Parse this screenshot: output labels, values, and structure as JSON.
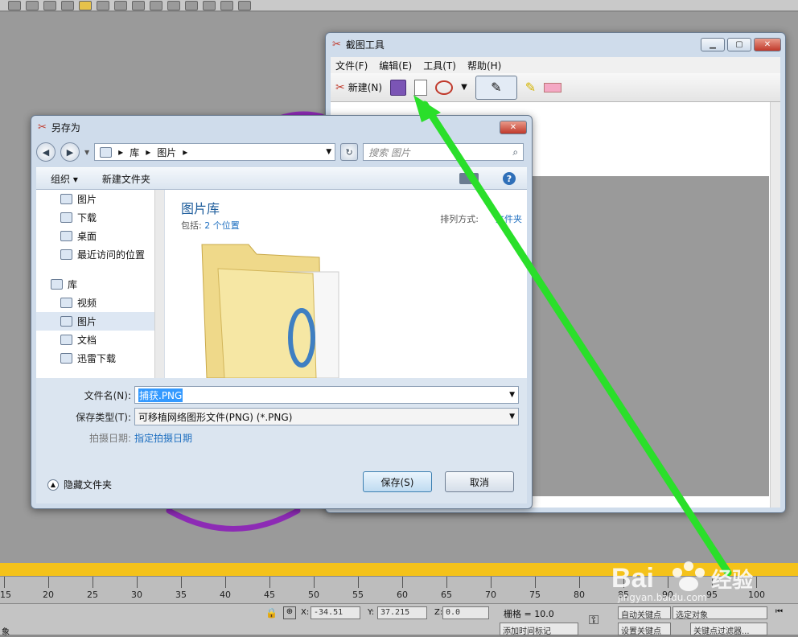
{
  "snip": {
    "title": "截图工具",
    "menu": [
      "文件(F)",
      "编辑(E)",
      "工具(T)",
      "帮助(H)"
    ],
    "new_label": "新建(N)"
  },
  "dialog": {
    "title": "另存为",
    "breadcrumb": [
      "库",
      "图片"
    ],
    "search_placeholder": "搜索 图片",
    "organize": "组织 ▾",
    "new_folder": "新建文件夹",
    "nav": {
      "favorites": [
        "图片",
        "下载",
        "桌面",
        "最近访问的位置"
      ],
      "library_header": "库",
      "libraries": [
        "视频",
        "图片",
        "文档",
        "迅雷下载"
      ]
    },
    "library_title": "图片库",
    "library_includes_label": "包括:",
    "library_includes_link": "2 个位置",
    "sort_label": "排列方式:",
    "sort_value": "文件夹",
    "filename_label": "文件名(N):",
    "filename_value": "捕获.PNG",
    "type_label": "保存类型(T):",
    "type_value": "可移植网络图形文件(PNG) (*.PNG)",
    "date_label": "拍摄日期:",
    "date_value": "指定拍摄日期",
    "hide_folders": "隐藏文件夹",
    "save": "保存(S)",
    "cancel": "取消"
  },
  "max": {
    "ruler": [
      "15",
      "20",
      "25",
      "30",
      "35",
      "40",
      "45",
      "50",
      "55",
      "60",
      "65",
      "70",
      "75",
      "80",
      "85",
      "90",
      "95",
      "100"
    ],
    "x_label": "X:",
    "x_value": "-34.51",
    "y_label": "Y:",
    "y_value": "37.215",
    "z_label": "Z:",
    "z_value": "0.0",
    "grid_label": "栅格 = 10.0",
    "autokey": "自动关键点",
    "selected": "选定对象",
    "setkey": "设置关键点",
    "keyfilter": "关键点过滤器...",
    "add_time_tag": "添加时间标记",
    "status_left": "象"
  },
  "watermark": {
    "logo": "Bai 经验",
    "url": "jingyan.baidu.com"
  },
  "colors": {
    "arrow": "#2adf2a",
    "wheel": "#8d2bb5",
    "stripe": "#f4c21a"
  }
}
